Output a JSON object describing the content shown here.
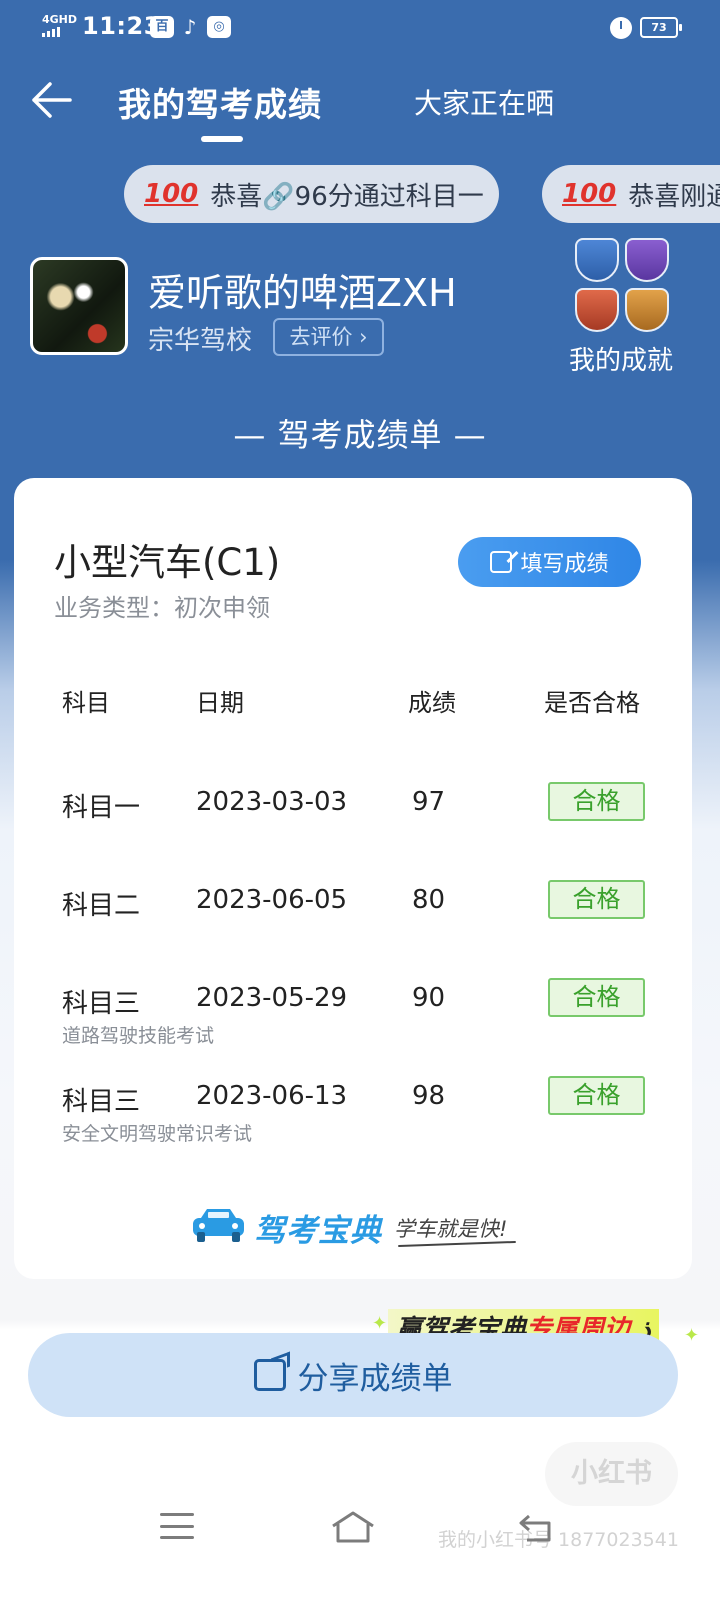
{
  "status_bar": {
    "network": "4GHD",
    "time": "11:23",
    "battery": "73"
  },
  "header": {
    "title": "我的驾考成绩",
    "tab2": "大家正在晒"
  },
  "ticker": [
    {
      "icon": "100",
      "text": "恭喜🔗96分通过科目一"
    },
    {
      "icon": "100",
      "text": "恭喜刚通"
    }
  ],
  "profile": {
    "username": "爱听歌的啤酒ZXH",
    "school": "宗华驾校",
    "rate_button": "去评价",
    "achievements_label": "我的成就",
    "badges": [
      "blue-badge",
      "purple-badge",
      "red-badge",
      "gold-badge"
    ]
  },
  "section_title": "— 驾考成绩单 —",
  "card": {
    "vehicle_type": "小型汽车(C1)",
    "business_type": "业务类型：初次申领",
    "fill_button": "填写成绩",
    "headers": [
      "科目",
      "日期",
      "成绩",
      "是否合格"
    ],
    "rows": [
      {
        "subject": "科目一",
        "date": "2023-03-03",
        "score": "97",
        "status": "合格",
        "note": ""
      },
      {
        "subject": "科目二",
        "date": "2023-06-05",
        "score": "80",
        "status": "合格",
        "note": ""
      },
      {
        "subject": "科目三",
        "date": "2023-05-29",
        "score": "90",
        "status": "合格",
        "note": "道路驾驶技能考试"
      },
      {
        "subject": "科目三",
        "date": "2023-06-13",
        "score": "98",
        "status": "合格",
        "note": "安全文明驾驶常识考试"
      }
    ],
    "brand": "驾考宝典",
    "slogan": "学车就是快!"
  },
  "promo": {
    "part1": "赢驾考宝典",
    "part2": "专属周边",
    "emoji": "ذ"
  },
  "share_button": "分享成绩单",
  "watermark": {
    "logo": "小红书",
    "account": "我的小红书号 1877023541"
  },
  "colors": {
    "header_bg": "#3a6cae",
    "accent": "#2f86e6",
    "pass_green": "#3aa12c"
  }
}
